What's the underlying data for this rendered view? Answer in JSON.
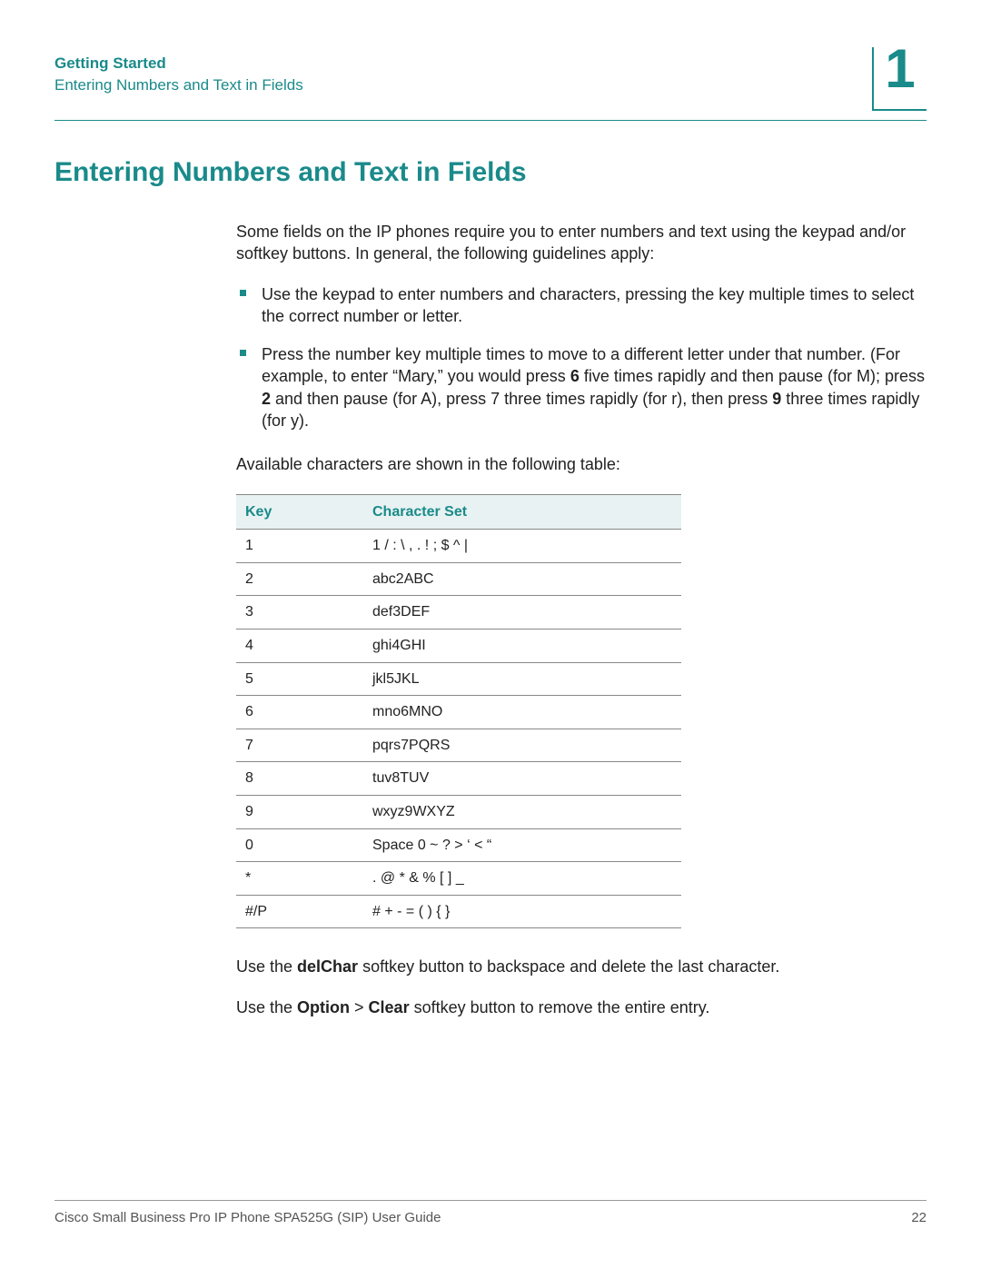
{
  "header": {
    "chapter_label": "Getting Started",
    "section_label": "Entering Numbers and Text in Fields",
    "chapter_number": "1"
  },
  "title": "Entering Numbers and Text in Fields",
  "intro": "Some fields on the IP phones require you to enter numbers and text using the keypad and/or softkey buttons. In general, the following guidelines apply:",
  "bullets": [
    {
      "text": "Use the keypad to enter numbers and characters, pressing the key multiple times to select the correct number or letter."
    },
    {
      "prefix": "Press the number key multiple times to move to a different letter under that number. (For example, to enter “Mary,” you would press ",
      "b1": "6",
      "mid1": " five times rapidly and then pause (for M); press ",
      "b2": "2",
      "mid2": " and then pause (for A), press 7 three times rapidly (for r), then press ",
      "b3": "9",
      "suffix": " three times rapidly (for y)."
    }
  ],
  "table_intro": "Available characters are shown in the following table:",
  "table": {
    "headers": [
      "Key",
      "Character Set"
    ],
    "rows": [
      [
        "1",
        "1 / : \\ , . ! ; $ ^ |"
      ],
      [
        "2",
        "abc2ABC"
      ],
      [
        "3",
        "def3DEF"
      ],
      [
        "4",
        "ghi4GHI"
      ],
      [
        "5",
        "jkl5JKL"
      ],
      [
        "6",
        "mno6MNO"
      ],
      [
        "7",
        "pqrs7PQRS"
      ],
      [
        "8",
        "tuv8TUV"
      ],
      [
        "9",
        "wxyz9WXYZ"
      ],
      [
        "0",
        "Space 0 ~ ? > ‘ < “"
      ],
      [
        "*",
        ". @ * & % [ ] _"
      ],
      [
        "#/P",
        "# + - = ( ) { }"
      ]
    ]
  },
  "after_table": {
    "p1_prefix": "Use the ",
    "p1_bold": "delChar",
    "p1_suffix": " softkey button to backspace and delete the last character.",
    "p2_prefix": "Use the ",
    "p2_bold1": "Option",
    "p2_mid": " > ",
    "p2_bold2": "Clear",
    "p2_suffix": " softkey button to remove the entire entry."
  },
  "footer": {
    "doc_title": "Cisco Small Business Pro IP Phone SPA525G (SIP) User Guide",
    "page_number": "22"
  }
}
